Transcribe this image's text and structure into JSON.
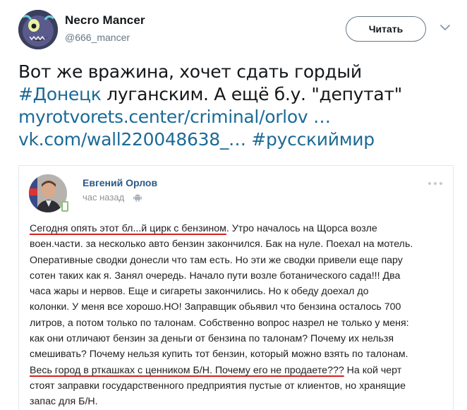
{
  "author": {
    "name": "Necro Mancer",
    "handle": "@666_mancer",
    "avatar_icon": "monster-avatar-icon"
  },
  "follow_button": {
    "label": "Читать"
  },
  "menu_icon": "chevron-down-icon",
  "tweet": {
    "line1": "Вот же вражина, хочет сдать гордый",
    "hashtag1": "#Донецк",
    "line2_rest": " луганским. А ещё б.у. \"депутат\"",
    "link1": "myrotvorets.center/criminal/orlov …",
    "link2": "vk.com/wall220048638_…",
    "hashtag2": "#русскиймир"
  },
  "vk_post": {
    "author_name": "Евгений Орлов",
    "time": "час назад",
    "platform_icon": "android-icon",
    "menu_icon": "more-dots-icon",
    "underline_color": "#d62020",
    "line1_ul": "Сегодня опять этот бл...й цирк с бензином",
    "line1_rest": ". Утро началось на Щорса возле",
    "line2": "воен.части. за несколько авто бензин закончился. Бак на нуле. Поехал на мотель.",
    "line3": "Оперативные сводки донесли что там есть. Но эти же сводки привели еще пару",
    "line4": "сотен таких как я. Занял очередь. Начало пути возле ботанического сада!!! Два",
    "line5": "часа жары и нервов. Еще и сигареты закончились. Но к обеду доехал до",
    "line6": "колонки. У меня все хорошо.НО! Заправщик обьявил что бензина осталось 700",
    "line7": "литров, а потом только по талонам. Собственно вопрос назрел не только у меня:",
    "line8": "как они отличают бензин за деньги от бензина по талонам? Почему их нельзя",
    "line9": "смешивать? Почему нельзя купить тот бензин, который можно взять по талонам.",
    "line10_ul": "Весь город в рткашках с ценником Б/Н. Почему его не продаете???",
    "line10_rest": " На кой черт",
    "line11": "стоят заправки государственного предприятия пустые от клиентов, но хранящие",
    "line12": "запас для Б/Н."
  },
  "colors": {
    "link": "#1b6a97",
    "vk_name": "#2a5885",
    "muted": "#657786"
  }
}
